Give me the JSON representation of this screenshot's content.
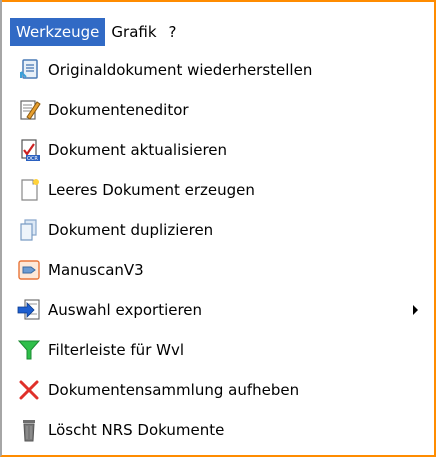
{
  "menubar": {
    "items": [
      {
        "label": "Werkzeuge"
      },
      {
        "label": "Grafik"
      },
      {
        "label": "?"
      }
    ]
  },
  "menu": {
    "items": [
      {
        "label": "Originaldokument wiederherstellen",
        "icon": "document-restore-icon"
      },
      {
        "label": "Dokumenteneditor",
        "icon": "document-editor-icon"
      },
      {
        "label": "Dokument aktualisieren",
        "icon": "document-update-icon"
      },
      {
        "label": "Leeres Dokument erzeugen",
        "icon": "new-document-icon"
      },
      {
        "label": "Dokument duplizieren",
        "icon": "duplicate-document-icon"
      },
      {
        "label": "ManuscanV3",
        "icon": "manuscan-icon"
      },
      {
        "label": "Auswahl exportieren",
        "icon": "export-icon"
      },
      {
        "label": "Filterleiste für Wvl",
        "icon": "filter-icon"
      },
      {
        "label": "Dokumentensammlung aufheben",
        "icon": "remove-icon"
      },
      {
        "label": "Löscht NRS Dokumente",
        "icon": "trash-icon"
      }
    ]
  },
  "colors": {
    "menubar_active_bg": "#316ac5",
    "frame_accent": "#ff8c00"
  }
}
